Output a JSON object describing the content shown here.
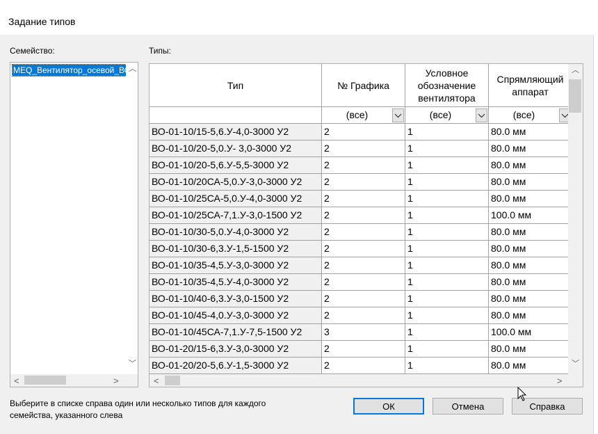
{
  "window": {
    "title": "Задание типов"
  },
  "family": {
    "label": "Семейство:",
    "items": [
      "MEQ_Вентилятор_осевой_ВО"
    ]
  },
  "types": {
    "label": "Типы:",
    "columns": [
      "Тип",
      "№ Графика",
      "Условное обозначение вентилятора",
      "Спрямляющий аппарат"
    ],
    "filters": [
      "",
      "(все)",
      "(все)",
      "(все)"
    ],
    "rows": [
      [
        "ВО-01-10/15-5,6.У-4,0-3000 У2",
        "2",
        "1",
        "80.0 мм"
      ],
      [
        "ВО-01-10/20-5,0.У- 3,0-3000 У2",
        "2",
        "1",
        "80.0 мм"
      ],
      [
        "ВО-01-10/20-5,6.У-5,5-3000 У2",
        "2",
        "1",
        "80.0 мм"
      ],
      [
        "ВО-01-10/20СА-5,0.У-3,0-3000 У2",
        "2",
        "1",
        "80.0 мм"
      ],
      [
        "ВО-01-10/25СА-5,0.У-4,0-3000 У2",
        "2",
        "1",
        "80.0 мм"
      ],
      [
        "ВО-01-10/25СА-7,1.У-3,0-1500 У2",
        "2",
        "1",
        "100.0 мм"
      ],
      [
        "ВО-01-10/30-5,0.У-4,0-3000 У2",
        "2",
        "1",
        "80.0 мм"
      ],
      [
        "ВО-01-10/30-6,3.У-1,5-1500 У2",
        "2",
        "1",
        "80.0 мм"
      ],
      [
        "ВО-01-10/35-4,5.У-3,0-3000 У2",
        "2",
        "1",
        "80.0 мм"
      ],
      [
        "ВО-01-10/35-4,5.У-4,0-3000 У2",
        "2",
        "1",
        "80.0 мм"
      ],
      [
        "ВО-01-10/40-6,3.У-3,0-1500 У2",
        "2",
        "1",
        "80.0 мм"
      ],
      [
        "ВО-01-10/45-4,0.У-3,0-3000 У2",
        "2",
        "1",
        "80.0 мм"
      ],
      [
        "ВО-01-10/45СА-7,1.У-7,5-1500 У2",
        "3",
        "1",
        "100.0 мм"
      ],
      [
        "ВО-01-20/15-6,3.У-3,0-3000 У2",
        "2",
        "1",
        "80.0 мм"
      ],
      [
        "ВО-01-20/20-5,6.У-1,5-3000 У2",
        "2",
        "1",
        "80.0 мм"
      ]
    ]
  },
  "hint": "Выберите в списке справа один или несколько типов для каждого семейства, указанного слева",
  "buttons": {
    "ok": "ОК",
    "cancel": "Отмена",
    "help": "Справка"
  },
  "colors": {
    "selection": "#0078d7",
    "dialog_bg": "#f0f0f0"
  }
}
